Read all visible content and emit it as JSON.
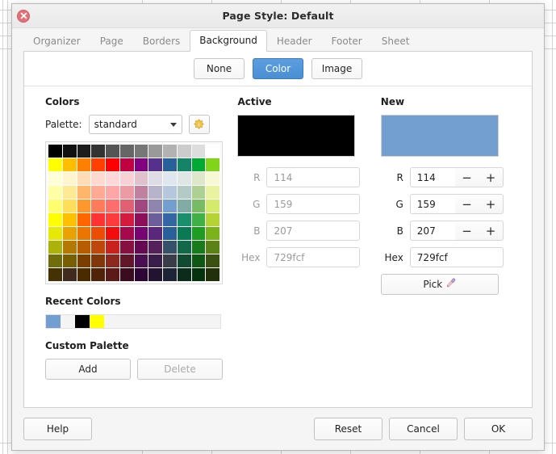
{
  "window": {
    "title": "Page Style: Default",
    "close_icon": "close-icon"
  },
  "tabs": [
    {
      "label": "Organizer",
      "active": false
    },
    {
      "label": "Page",
      "active": false
    },
    {
      "label": "Borders",
      "active": false
    },
    {
      "label": "Background",
      "active": true
    },
    {
      "label": "Header",
      "active": false
    },
    {
      "label": "Footer",
      "active": false
    },
    {
      "label": "Sheet",
      "active": false
    }
  ],
  "mode_buttons": [
    {
      "label": "None",
      "selected": false
    },
    {
      "label": "Color",
      "selected": true
    },
    {
      "label": "Image",
      "selected": false
    }
  ],
  "colors_section": {
    "title": "Colors",
    "palette_label": "Palette:",
    "palette_value": "standard",
    "palette_options": [
      "standard"
    ],
    "gear_icon": "palette-settings-icon",
    "dropdown_icon": "chevron-down-icon",
    "grid": {
      "columns": 12,
      "rows": 10,
      "swatches": [
        [
          "#000000",
          "#111111",
          "#1c1c1c",
          "#333333",
          "#555555",
          "#666666",
          "#777777",
          "#999999",
          "#b2b2b2",
          "#cccccc",
          "#dddddd",
          "#ffffff"
        ],
        [
          "#ffff00",
          "#ffbf00",
          "#ff8000",
          "#ff4000",
          "#ff0000",
          "#bf0041",
          "#800080",
          "#55308d",
          "#2a6099",
          "#158466",
          "#00a933",
          "#81d41a"
        ],
        [
          "#ffffd7",
          "#fff5ce",
          "#ffdbb6",
          "#ffd8ce",
          "#ffd7d7",
          "#f7d1d5",
          "#e0c2cd",
          "#dedce6",
          "#dee6ef",
          "#dee7e5",
          "#dde8cb",
          "#f6f9d4"
        ],
        [
          "#ffffa6",
          "#ffe994",
          "#ffb66c",
          "#ffaa95",
          "#ffa6a6",
          "#ec9ba4",
          "#bf819e",
          "#b7b3ca",
          "#b4c7dc",
          "#b3cac7",
          "#afd095",
          "#e8f2a1"
        ],
        [
          "#ffff6d",
          "#ffde59",
          "#ff972f",
          "#ff7b59",
          "#ff6d6d",
          "#e16173",
          "#a1467e",
          "#8e86ae",
          "#729fcf",
          "#81aca6",
          "#77bc65",
          "#d4ea6b"
        ],
        [
          "#ffff00",
          "#ffc000",
          "#ff6600",
          "#ff3333",
          "#ff3b3b",
          "#d31b3d",
          "#8d0f5a",
          "#6b5e9b",
          "#3465a4",
          "#1a8f6b",
          "#3faf46",
          "#b5d334"
        ],
        [
          "#e6e905",
          "#e8a202",
          "#ea7500",
          "#ed4c05",
          "#f10d0c",
          "#a7074b",
          "#780373",
          "#5b277d",
          "#2a6099",
          "#0a7a55",
          "#1f9c22",
          "#7bb31a"
        ],
        [
          "#acb20c",
          "#b47804",
          "#b85c00",
          "#be480a",
          "#c9211e",
          "#861141",
          "#650953",
          "#55215b",
          "#355269",
          "#126849",
          "#197a1c",
          "#5b8216"
        ],
        [
          "#706e0c",
          "#785f04",
          "#7b3d00",
          "#813709",
          "#8d281e",
          "#611729",
          "#4b0e52",
          "#3b1d4b",
          "#393d4a",
          "#104a30",
          "#0e5715",
          "#3b5111"
        ],
        [
          "#443205",
          "#412b1e",
          "#4a2a00",
          "#50220a",
          "#5b1a18",
          "#3b0b1e",
          "#2e0636",
          "#221431",
          "#1d2438",
          "#0b2c1b",
          "#05330d",
          "#23300c"
        ]
      ]
    },
    "recent_title": "Recent Colors",
    "recent_colors": [
      "#729fcf",
      "",
      "#000000",
      "#ffff00"
    ],
    "custom_title": "Custom Palette",
    "custom_add_label": "Add",
    "custom_delete_label": "Delete",
    "custom_delete_disabled": true
  },
  "active_section": {
    "title": "Active",
    "swatch_color": "#000000",
    "fields": [
      {
        "label": "R",
        "value": "114"
      },
      {
        "label": "G",
        "value": "159"
      },
      {
        "label": "B",
        "value": "207"
      }
    ],
    "hex_label": "Hex",
    "hex_value": "729fcf",
    "disabled": true
  },
  "new_section": {
    "title": "New",
    "swatch_color": "#729fcf",
    "fields": [
      {
        "label": "R",
        "value": "114",
        "minus": "−",
        "plus": "+"
      },
      {
        "label": "G",
        "value": "159",
        "minus": "−",
        "plus": "+"
      },
      {
        "label": "B",
        "value": "207",
        "minus": "−",
        "plus": "+"
      }
    ],
    "hex_label": "Hex",
    "hex_value": "729fcf",
    "pick_label": "Pick",
    "pick_icon": "eyedropper-icon"
  },
  "footer": {
    "help_label": "Help",
    "reset_label": "Reset",
    "cancel_label": "Cancel",
    "ok_label": "OK"
  },
  "theme": {
    "accent": "#4a8fd4",
    "selected_color": "#729fcf",
    "close_red": "#e4717a"
  }
}
